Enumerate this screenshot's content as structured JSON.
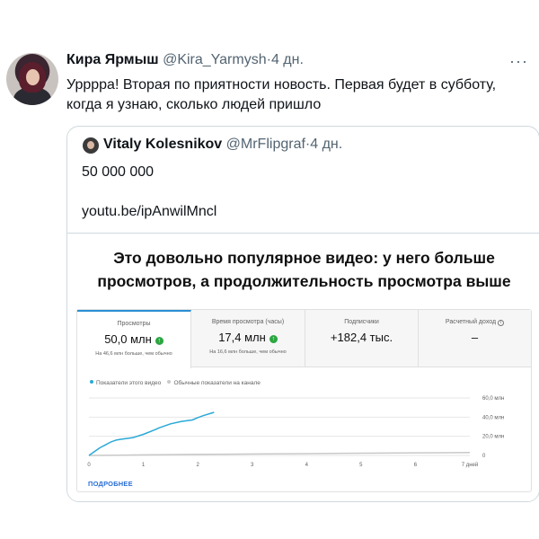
{
  "tweet": {
    "author_name": "Кира Ярмыш",
    "author_handle": "@Kira_Yarmysh",
    "separator": "·",
    "time": "4 дн.",
    "more": "···",
    "text": "Урррра! Вторая по приятности новость. Первая будет в субботу, когда я узнаю, сколько людей пришло"
  },
  "quote": {
    "author_name": "Vitaly Kolesnikov",
    "author_handle": "@MrFlipgraf",
    "separator": "·",
    "time": "4 дн.",
    "line1": "50 000 000",
    "line2": "youtu.be/ipAnwilMncl"
  },
  "media": {
    "title": "Это довольно популярное видео: у него больше просмотров, а продолжительность просмотра выше",
    "metrics": [
      {
        "label": "Просмотры",
        "value": "50,0 млн",
        "arrow": "↑",
        "sub": "На 46,6 млн больше, чем обычно"
      },
      {
        "label": "Время просмотра (часы)",
        "value": "17,4 млн",
        "arrow": "↑",
        "sub": "На 16,6 млн больше, чем обычно"
      },
      {
        "label": "Подписчики",
        "value": "+182,4 тыс.",
        "arrow": "",
        "sub": ""
      },
      {
        "label": "Расчетный доход",
        "value": "–",
        "arrow": "",
        "sub": "",
        "info": "i"
      }
    ],
    "legend": {
      "this_video": "Показатели этого видео",
      "typical": "Обычные показатели на канале"
    },
    "more_link": "ПОДРОБНЕЕ",
    "colors": {
      "this_video": "#2aa9d6",
      "typical": "#c8c8c8",
      "accent": "#2a8fd6",
      "up": "#2ba640"
    }
  },
  "chart_data": {
    "type": "line",
    "x_tick_labels": [
      "0",
      "1",
      "2",
      "3",
      "4",
      "5",
      "6",
      "7 дней"
    ],
    "y_tick_labels": [
      "0",
      "20,0 млн",
      "40,0 млн",
      "60,0 млн"
    ],
    "xlim": [
      0,
      7
    ],
    "ylim": [
      0,
      60
    ],
    "grid": true,
    "series": [
      {
        "name": "Показатели этого видео",
        "color": "#2aa9d6",
        "x": [
          0,
          0.1,
          0.2,
          0.3,
          0.4,
          0.5,
          0.6,
          0.8,
          1.0,
          1.2,
          1.3,
          1.5,
          1.7,
          1.9,
          2.0,
          2.1,
          2.3
        ],
        "y": [
          0,
          4,
          8,
          11,
          14,
          16,
          17,
          18.5,
          22,
          26.5,
          29,
          33,
          35.5,
          37,
          39.5,
          41.5,
          45
        ]
      },
      {
        "name": "Обычные показатели на канале",
        "color": "#c8c8c8",
        "x": [
          0,
          1,
          2,
          3,
          4,
          5,
          6,
          7
        ],
        "y": [
          0,
          0.6,
          1.1,
          1.5,
          1.9,
          2.3,
          2.7,
          3.0
        ]
      }
    ]
  }
}
